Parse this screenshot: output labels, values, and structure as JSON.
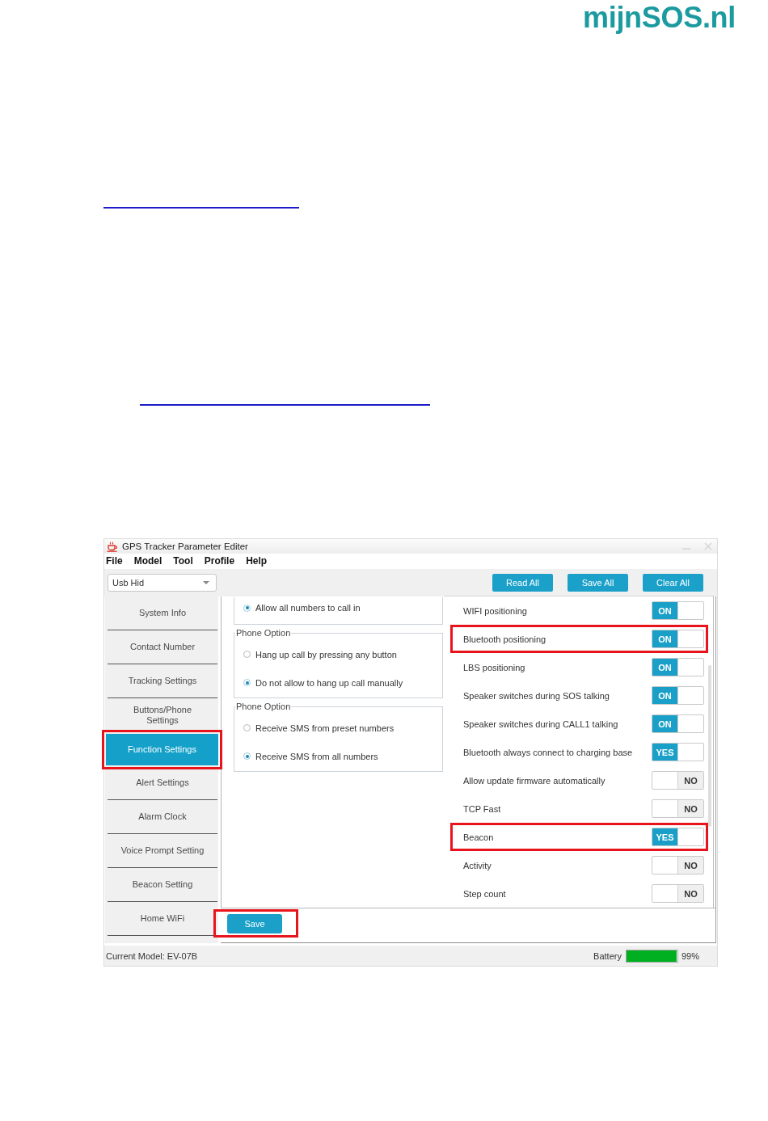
{
  "logo": {
    "text": "mijnSOS.nl"
  },
  "window": {
    "title": "GPS Tracker Parameter Editer"
  },
  "menu": [
    "File",
    "Model",
    "Tool",
    "Profile",
    "Help"
  ],
  "toolbar": {
    "connection": {
      "value": "Usb Hid"
    },
    "buttons": [
      "Read All",
      "Save All",
      "Clear All"
    ]
  },
  "sidebar": {
    "items": [
      {
        "label": "System Info",
        "selected": false,
        "highlighted": false
      },
      {
        "label": "Contact Number",
        "selected": false,
        "highlighted": false
      },
      {
        "label": "Tracking Settings",
        "selected": false,
        "highlighted": false
      },
      {
        "label": "Buttons/Phone Settings",
        "selected": false,
        "highlighted": false
      },
      {
        "label": "Function Settings",
        "selected": true,
        "highlighted": true
      },
      {
        "label": "Alert Settings",
        "selected": false,
        "highlighted": false
      },
      {
        "label": "Alarm Clock",
        "selected": false,
        "highlighted": false
      },
      {
        "label": "Voice Prompt Setting",
        "selected": false,
        "highlighted": false
      },
      {
        "label": "Beacon Setting",
        "selected": false,
        "highlighted": false
      },
      {
        "label": "Home WiFi",
        "selected": false,
        "highlighted": false
      }
    ]
  },
  "option_groups": [
    {
      "options": [
        {
          "label": "Allow all numbers to call in",
          "selected": true
        }
      ]
    },
    {
      "legend": "Phone Option",
      "options": [
        {
          "label": "Hang up call by pressing any button",
          "selected": false
        },
        {
          "label": "Do not allow to hang up call manually",
          "selected": true
        }
      ]
    },
    {
      "legend": "Phone Option",
      "options": [
        {
          "label": "Receive SMS from preset numbers",
          "selected": false
        },
        {
          "label": "Receive SMS from all numbers",
          "selected": true
        }
      ]
    }
  ],
  "toggle_rows": [
    {
      "label": "WIFI positioning",
      "on": true,
      "text": "ON",
      "highlighted": false
    },
    {
      "label": "Bluetooth positioning",
      "on": true,
      "text": "ON",
      "highlighted": true
    },
    {
      "label": "LBS positioning",
      "on": true,
      "text": "ON",
      "highlighted": false
    },
    {
      "label": "Speaker switches during SOS talking",
      "on": true,
      "text": "ON",
      "highlighted": false
    },
    {
      "label": "Speaker switches during CALL1 talking",
      "on": true,
      "text": "ON",
      "highlighted": false
    },
    {
      "label": "Bluetooth always connect to charging base",
      "on": true,
      "text": "YES",
      "highlighted": false
    },
    {
      "label": "Allow update firmware automatically",
      "on": false,
      "text": "NO",
      "highlighted": false
    },
    {
      "label": "TCP Fast",
      "on": false,
      "text": "NO",
      "highlighted": false
    },
    {
      "label": "Beacon",
      "on": true,
      "text": "YES",
      "highlighted": true
    },
    {
      "label": "Activity",
      "on": false,
      "text": "NO",
      "highlighted": false
    },
    {
      "label": "Step count",
      "on": false,
      "text": "NO",
      "highlighted": false
    }
  ],
  "save_button": {
    "label": "Save",
    "highlighted": true
  },
  "status_bar": {
    "model": "Current Model: EV-07B",
    "battery": {
      "label": "Battery",
      "level": 0.99,
      "reading": "99%"
    }
  }
}
